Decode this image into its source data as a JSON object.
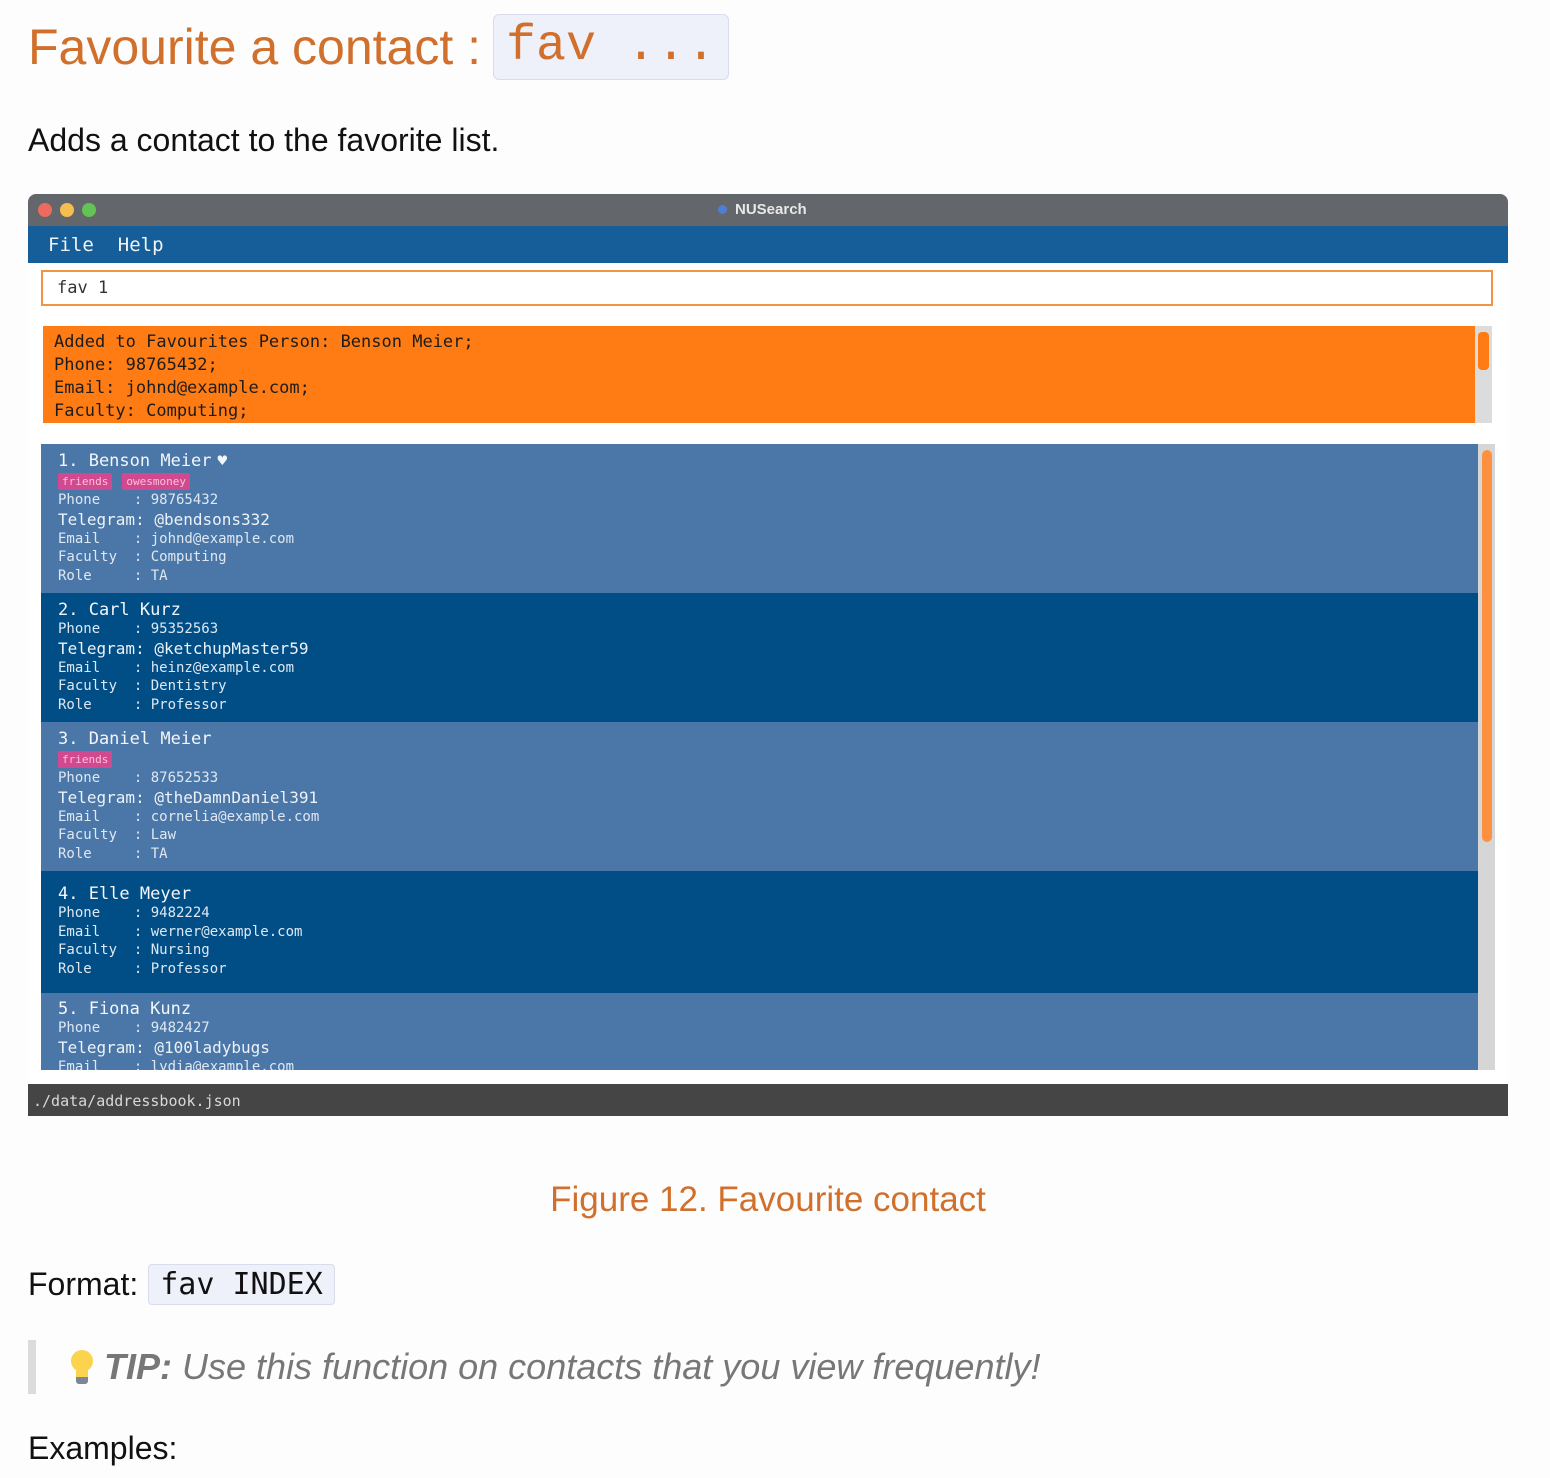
{
  "doc": {
    "heading": "Favourite a contact :",
    "heading_code": "fav ...",
    "intro": "Adds a contact to the favorite list.",
    "caption": "Figure 12. Favourite contact",
    "format_label": "Format:",
    "format_code": "fav INDEX",
    "tip_label": "TIP:",
    "tip_text": "Use this function on contacts that you view frequently!",
    "examples_label": "Examples:",
    "tip_icon": "lightbulb-icon"
  },
  "app": {
    "title": "NUSearch",
    "menu": [
      "File",
      "Help"
    ],
    "command_value": "fav 1",
    "result_lines": [
      "Added to Favourites Person: Benson Meier;",
      "Phone: 98765432;",
      "Email: johnd@example.com;",
      "Faculty: Computing;"
    ],
    "status_path": "./data/addressbook.json",
    "accent": "#fe7c13",
    "menubar_color": "#155e99"
  },
  "contacts": [
    {
      "name": "1. Benson Meier",
      "favourite": true,
      "tags": [
        "friends",
        "owesmoney"
      ],
      "phone": "Phone    : 98765432",
      "telegram": "Telegram: @bendsons332",
      "email": "Email    : johnd@example.com",
      "faculty": "Faculty  : Computing",
      "role": "Role     : TA"
    },
    {
      "name": "2. Carl Kurz",
      "phone": "Phone    : 95352563",
      "telegram": "Telegram: @ketchupMaster59",
      "email": "Email    : heinz@example.com",
      "faculty": "Faculty  : Dentistry",
      "role": "Role     : Professor"
    },
    {
      "name": "3. Daniel Meier",
      "tags": [
        "friends"
      ],
      "phone": "Phone    : 87652533",
      "telegram": "Telegram: @theDamnDaniel391",
      "email": "Email    : cornelia@example.com",
      "faculty": "Faculty  : Law",
      "role": "Role     : TA"
    },
    {
      "name": "4. Elle Meyer",
      "phone": "Phone    : 9482224",
      "email": "Email    : werner@example.com",
      "faculty": "Faculty  : Nursing",
      "role": "Role     : Professor"
    },
    {
      "name": "5. Fiona Kunz",
      "phone": "Phone    : 9482427",
      "telegram": "Telegram: @100ladybugs",
      "email": "Email    : lydia@example.com"
    }
  ]
}
